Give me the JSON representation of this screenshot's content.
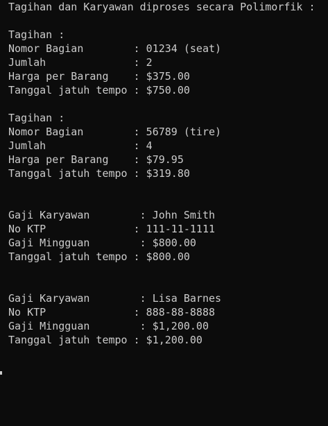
{
  "terminal": {
    "title_line": "Tagihan dan Karyawan diproses secara Polimorfik :",
    "invoices": [
      {
        "header": "Tagihan :",
        "part_line": "Nomor Bagian        : 01234 (seat)",
        "qty_line": "Jumlah              : 2",
        "price_line": "Harga per Barang    : $375.00",
        "due_line": "Tanggal jatuh tempo : $750.00"
      },
      {
        "header": "Tagihan :",
        "part_line": "Nomor Bagian        : 56789 (tire)",
        "qty_line": "Jumlah              : 4",
        "price_line": "Harga per Barang    : $79.95",
        "due_line": "Tanggal jatuh tempo : $319.80"
      }
    ],
    "employees": [
      {
        "name_line": "Gaji Karyawan        : John Smith",
        "ktp_line": "No KTP              : 111-11-1111",
        "salary_line": "Gaji Mingguan        : $800.00",
        "due_line": "Tanggal jatuh tempo : $800.00"
      },
      {
        "name_line": "Gaji Karyawan        : Lisa Barnes",
        "ktp_line": "No KTP              : 888-88-8888",
        "salary_line": "Gaji Mingguan        : $1,200.00",
        "due_line": "Tanggal jatuh tempo : $1,200.00"
      }
    ]
  },
  "colors": {
    "background": "#0c0c0c",
    "text": "#cccccc"
  }
}
